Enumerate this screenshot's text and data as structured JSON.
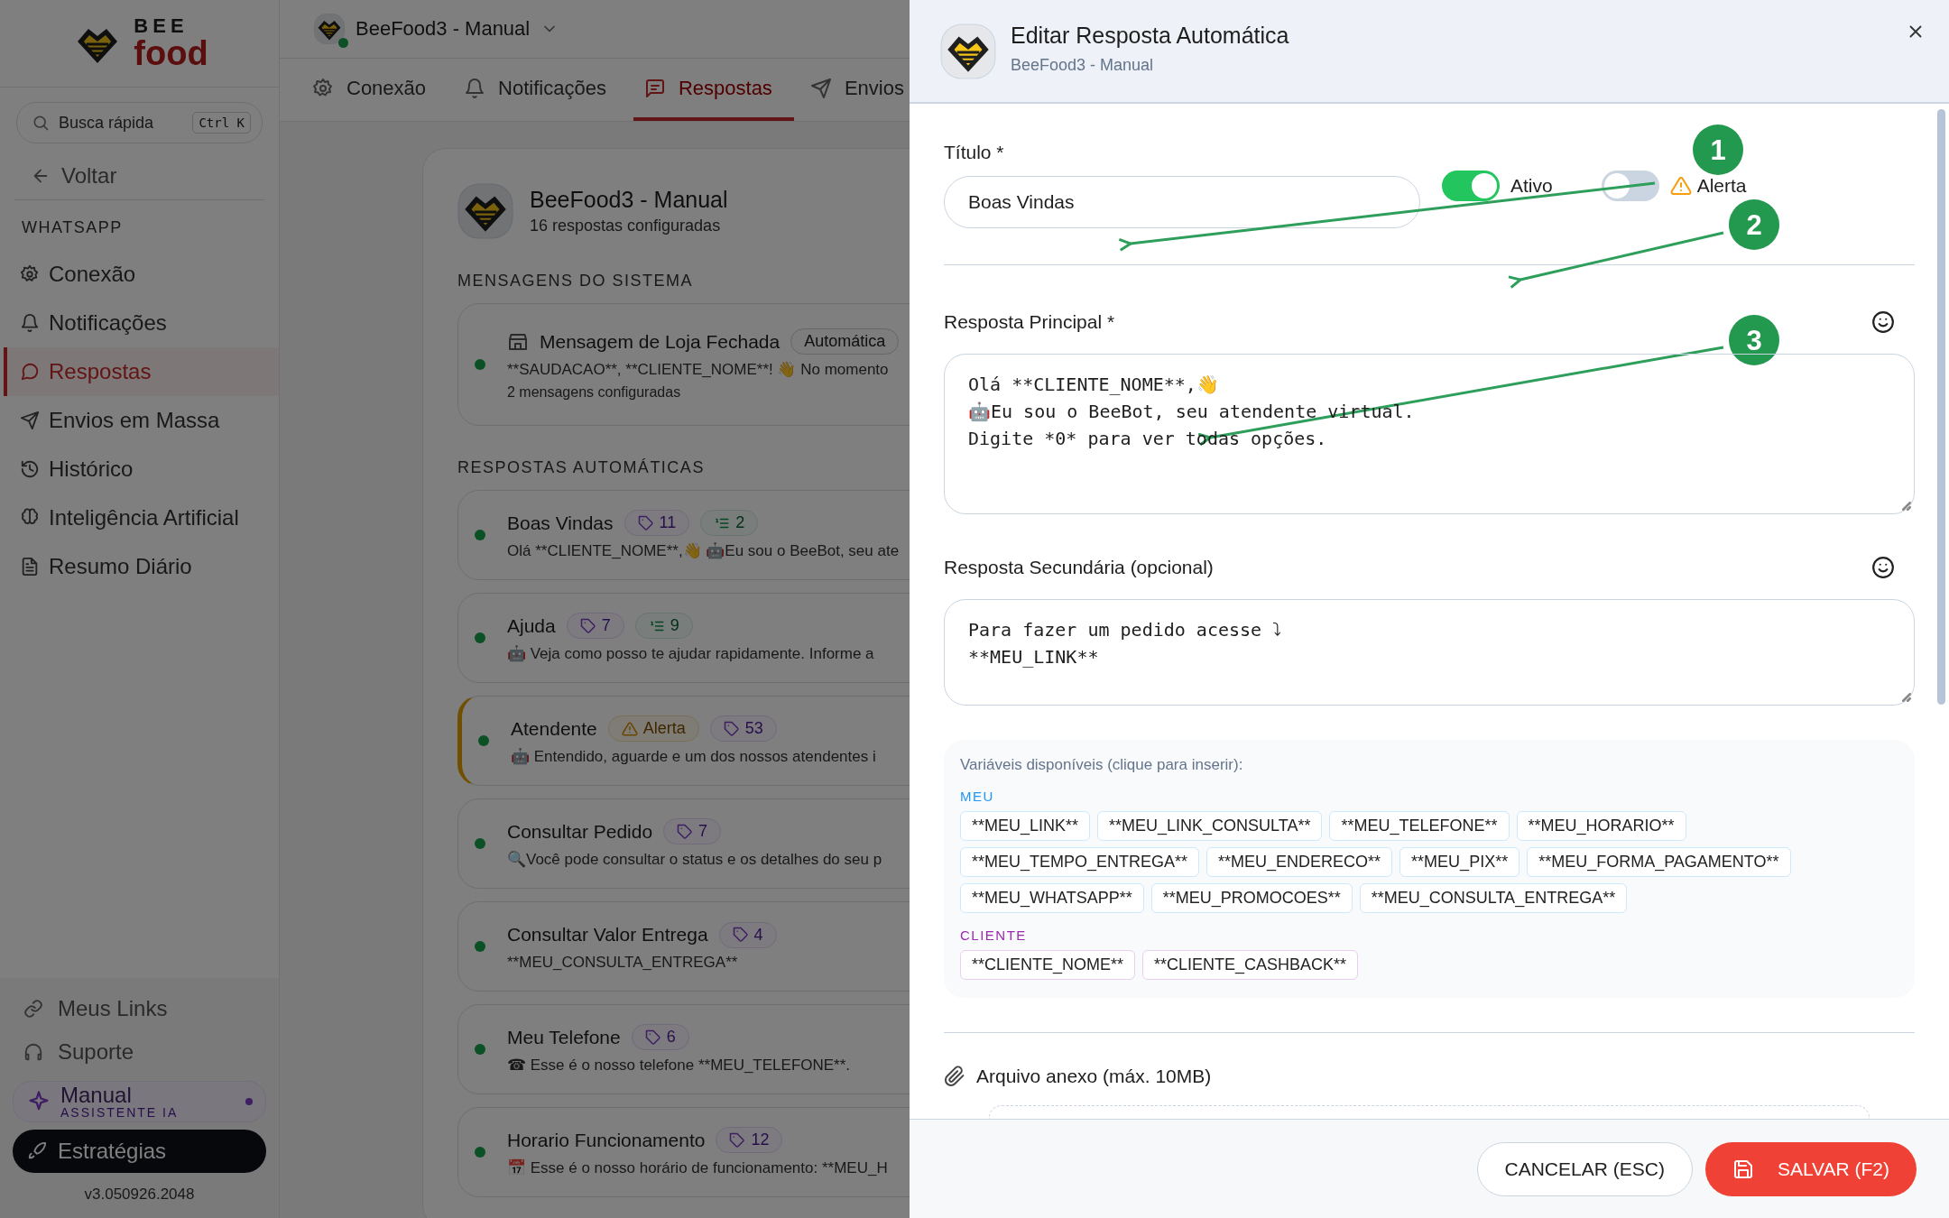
{
  "sidebar": {
    "logo": {
      "top": "BEE",
      "bottom": "food"
    },
    "search": {
      "placeholder": "Busca rápida",
      "shortcut": "Ctrl K"
    },
    "back": "Voltar",
    "section": "WHATSAPP",
    "items": [
      {
        "label": "Conexão",
        "selected": false
      },
      {
        "label": "Notificações",
        "selected": false
      },
      {
        "label": "Respostas",
        "selected": true
      },
      {
        "label": "Envios em Massa",
        "selected": false
      },
      {
        "label": "Histórico",
        "selected": false
      },
      {
        "label": "Inteligência Artificial",
        "selected": false
      },
      {
        "label": "Resumo Diário",
        "selected": false
      }
    ],
    "links": [
      "Meus Links",
      "Suporte"
    ],
    "assistant": {
      "title": "Manual",
      "subtitle": "ASSISTENTE IA"
    },
    "strategies": "Estratégias",
    "version": "v3.050926.2048"
  },
  "header": {
    "instance": "BeeFood3 - Manual",
    "online": true
  },
  "tabs": [
    {
      "label": "Conexão",
      "selected": false
    },
    {
      "label": "Notificações",
      "selected": false
    },
    {
      "label": "Respostas",
      "selected": true
    },
    {
      "label": "Envios",
      "selected": false
    }
  ],
  "panel": {
    "title": "BeeFood3 - Manual",
    "subtitle": "16 respostas configuradas",
    "system_section": "MENSAGENS DO SISTEMA",
    "system_items": [
      {
        "title": "Mensagem de Loja Fechada",
        "badge": "Automática",
        "preview": "**SAUDACAO**, **CLIENTE_NOME**! 👋 No momento",
        "meta": "2 mensagens configuradas",
        "active": true
      }
    ],
    "auto_section": "RESPOSTAS AUTOMÁTICAS",
    "auto_items": [
      {
        "title": "Boas Vindas",
        "active": true,
        "alert": false,
        "badges": [
          {
            "kind": "tags",
            "text": "11"
          },
          {
            "kind": "steps",
            "text": "2"
          }
        ],
        "preview": "Olá **CLIENTE_NOME**,👋 🤖Eu sou o BeeBot, seu ate"
      },
      {
        "title": "Ajuda",
        "active": true,
        "alert": false,
        "badges": [
          {
            "kind": "tags",
            "text": "7"
          },
          {
            "kind": "steps",
            "text": "9"
          }
        ],
        "preview": "🤖 Veja como posso te ajudar rapidamente. Informe a"
      },
      {
        "title": "Atendente",
        "active": true,
        "alert": true,
        "badges": [
          {
            "kind": "alert",
            "text": "Alerta"
          },
          {
            "kind": "tags",
            "text": "53"
          }
        ],
        "preview": "🤖 Entendido, aguarde e um dos nossos atendentes i"
      },
      {
        "title": "Consultar Pedido",
        "active": true,
        "alert": false,
        "badges": [
          {
            "kind": "tags",
            "text": "7"
          }
        ],
        "preview": "🔍Você pode consultar o status e os detalhes do seu p"
      },
      {
        "title": "Consultar Valor Entrega",
        "active": true,
        "alert": false,
        "badges": [
          {
            "kind": "tags",
            "text": "4"
          }
        ],
        "preview": "**MEU_CONSULTA_ENTREGA**"
      },
      {
        "title": "Meu Telefone",
        "active": true,
        "alert": false,
        "badges": [
          {
            "kind": "tags",
            "text": "6"
          }
        ],
        "preview": "☎ Esse é o nosso telefone **MEU_TELEFONE**."
      },
      {
        "title": "Horario Funcionamento",
        "active": true,
        "alert": false,
        "badges": [
          {
            "kind": "tags",
            "text": "12"
          }
        ],
        "preview": "📅 Esse é o nosso horário de funcionamento: **MEU_H"
      }
    ]
  },
  "drawer": {
    "title": "Editar Resposta Automática",
    "subtitle": "BeeFood3 - Manual",
    "title_label": "Título *",
    "title_value": "Boas Vindas",
    "toggles": [
      {
        "kind": "active",
        "label": "Ativo",
        "on": true
      },
      {
        "kind": "alert",
        "label": "Alerta",
        "on": false
      }
    ],
    "main_label": "Resposta Principal *",
    "main_value": "Olá **CLIENTE_NOME**,👋\n🤖Eu sou o BeeBot, seu atendente virtual.\nDigite *0* para ver todas opções.",
    "secondary_label": "Resposta Secundária (opcional)",
    "secondary_value": "Para fazer um pedido acesse ⤵\n**MEU_LINK**",
    "variables": {
      "hint": "Variáveis disponíveis (clique para inserir):",
      "groups": [
        {
          "name": "MEU",
          "color": "#2196f3",
          "items": [
            "**MEU_LINK**",
            "**MEU_LINK_CONSULTA**",
            "**MEU_TELEFONE**",
            "**MEU_HORARIO**",
            "**MEU_TEMPO_ENTREGA**",
            "**MEU_ENDERECO**",
            "**MEU_PIX**",
            "**MEU_FORMA_PAGAMENTO**",
            "**MEU_WHATSAPP**",
            "**MEU_PROMOCOES**",
            "**MEU_CONSULTA_ENTREGA**"
          ]
        },
        {
          "name": "CLIENTE",
          "color": "#9c27b0",
          "items": [
            "**CLIENTE_NOME**",
            "**CLIENTE_CASHBACK**"
          ]
        }
      ]
    },
    "attachment": "Arquivo anexo (máx. 10MB)",
    "cancel": "CANCELAR (ESC)",
    "save": "SALVAR (F2)"
  },
  "annotations": [
    {
      "label": "1"
    },
    {
      "label": "2"
    },
    {
      "label": "3"
    }
  ]
}
